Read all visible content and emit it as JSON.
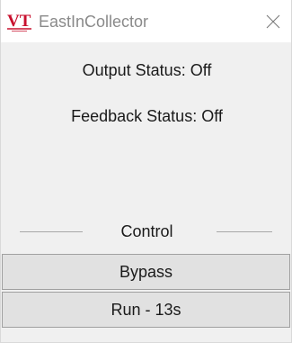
{
  "window": {
    "title": "EastInCollector",
    "logo_text": "VT",
    "logo_color": "#c8102e",
    "close_icon": "close-icon"
  },
  "status": {
    "output": "Output Status: Off",
    "feedback": "Feedback Status: Off"
  },
  "control_group": {
    "label": "Control",
    "buttons": [
      {
        "label": "Bypass"
      },
      {
        "label": "Run - 13s"
      }
    ]
  }
}
